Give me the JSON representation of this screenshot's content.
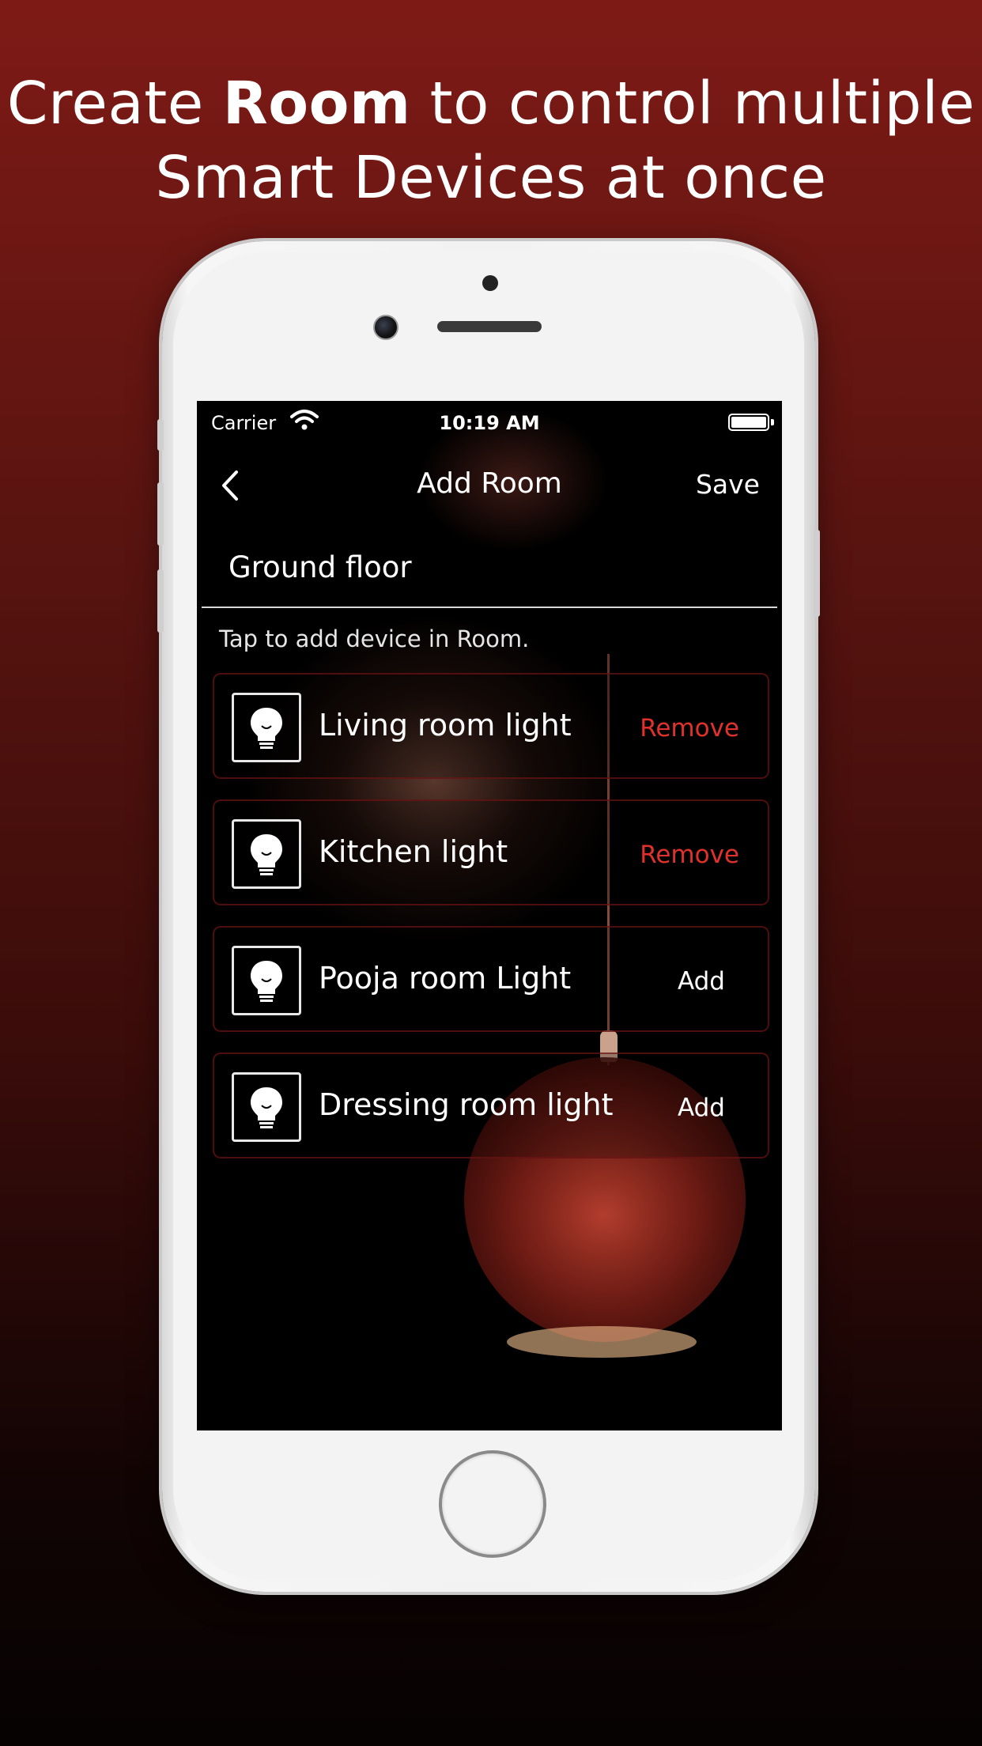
{
  "headline": {
    "line1_pre": "Create ",
    "line1_bold": "Room",
    "line1_post": " to control multiple",
    "line2": "Smart Devices at once"
  },
  "status_bar": {
    "carrier": "Carrier",
    "time": "10:19 AM",
    "wifi_icon": "wifi-icon",
    "battery_icon": "battery-icon"
  },
  "nav": {
    "back_icon": "chevron-left-icon",
    "title": "Add Room",
    "save_label": "Save"
  },
  "room_name": {
    "value": "Ground floor"
  },
  "hint": "Tap to add device in Room.",
  "devices": [
    {
      "name": "Living room light",
      "action": "Remove",
      "icon": "lightbulb-icon"
    },
    {
      "name": "Kitchen light",
      "action": "Remove",
      "icon": "lightbulb-icon"
    },
    {
      "name": "Pooja room Light",
      "action": "Add",
      "icon": "lightbulb-icon"
    },
    {
      "name": "Dressing room light",
      "action": "Add",
      "icon": "lightbulb-icon"
    }
  ],
  "colors": {
    "remove": "#e0312d",
    "background_top": "#7e1a16",
    "background_bottom": "#060202"
  }
}
